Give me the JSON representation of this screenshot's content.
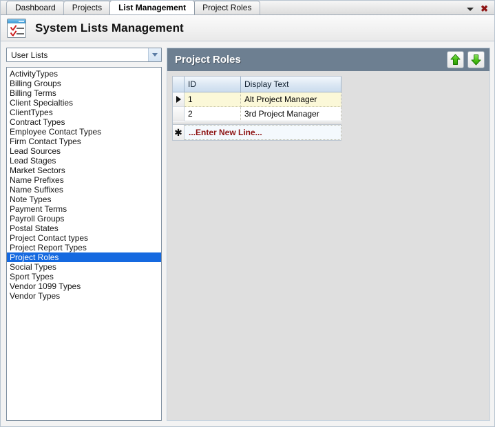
{
  "window": {
    "tabs": [
      {
        "label": "Dashboard",
        "active": false
      },
      {
        "label": "Projects",
        "active": false
      },
      {
        "label": "List Management",
        "active": true
      },
      {
        "label": "Project Roles",
        "active": false
      }
    ],
    "tab_overflow_icon": "chevron-down-icon",
    "close_icon": "close-icon",
    "close_glyph": "✖"
  },
  "header": {
    "app_icon": "checklist-window-icon",
    "title": "System Lists Management"
  },
  "sidebar": {
    "combo": {
      "value": "User Lists",
      "arrow_icon": "chevron-down-icon"
    },
    "items": [
      {
        "label": "ActivityTypes",
        "selected": false
      },
      {
        "label": "Billing Groups",
        "selected": false
      },
      {
        "label": "Billing Terms",
        "selected": false
      },
      {
        "label": "Client Specialties",
        "selected": false
      },
      {
        "label": "ClientTypes",
        "selected": false
      },
      {
        "label": "Contract Types",
        "selected": false
      },
      {
        "label": "Employee Contact Types",
        "selected": false
      },
      {
        "label": "Firm Contact Types",
        "selected": false
      },
      {
        "label": "Lead Sources",
        "selected": false
      },
      {
        "label": "Lead Stages",
        "selected": false
      },
      {
        "label": "Market Sectors",
        "selected": false
      },
      {
        "label": "Name Prefixes",
        "selected": false
      },
      {
        "label": "Name Suffixes",
        "selected": false
      },
      {
        "label": "Note Types",
        "selected": false
      },
      {
        "label": "Payment Terms",
        "selected": false
      },
      {
        "label": "Payroll Groups",
        "selected": false
      },
      {
        "label": "Postal States",
        "selected": false
      },
      {
        "label": "Project Contact types",
        "selected": false
      },
      {
        "label": "Project Report Types",
        "selected": false
      },
      {
        "label": "Project Roles",
        "selected": true
      },
      {
        "label": "Social Types",
        "selected": false
      },
      {
        "label": "Sport Types",
        "selected": false
      },
      {
        "label": "Vendor 1099 Types",
        "selected": false
      },
      {
        "label": "Vendor Types",
        "selected": false
      }
    ]
  },
  "panel": {
    "title": "Project Roles",
    "move_up_icon": "arrow-up-icon",
    "move_down_icon": "arrow-down-icon",
    "grid": {
      "columns": [
        "ID",
        "Display Text"
      ],
      "rows": [
        {
          "id": "1",
          "display_text": "Alt Project Manager",
          "current": true
        },
        {
          "id": "2",
          "display_text": "3rd Project Manager",
          "current": false
        }
      ],
      "new_row": {
        "marker_icon": "asterisk-icon",
        "marker_glyph": "✱",
        "label": "...Enter New Line..."
      }
    }
  },
  "colors": {
    "panel_header": "#6d7f91",
    "selection": "#1569e0",
    "current_row": "#fbf8d8",
    "new_row_text": "#8e1414",
    "arrow_green": "#4cc417"
  }
}
